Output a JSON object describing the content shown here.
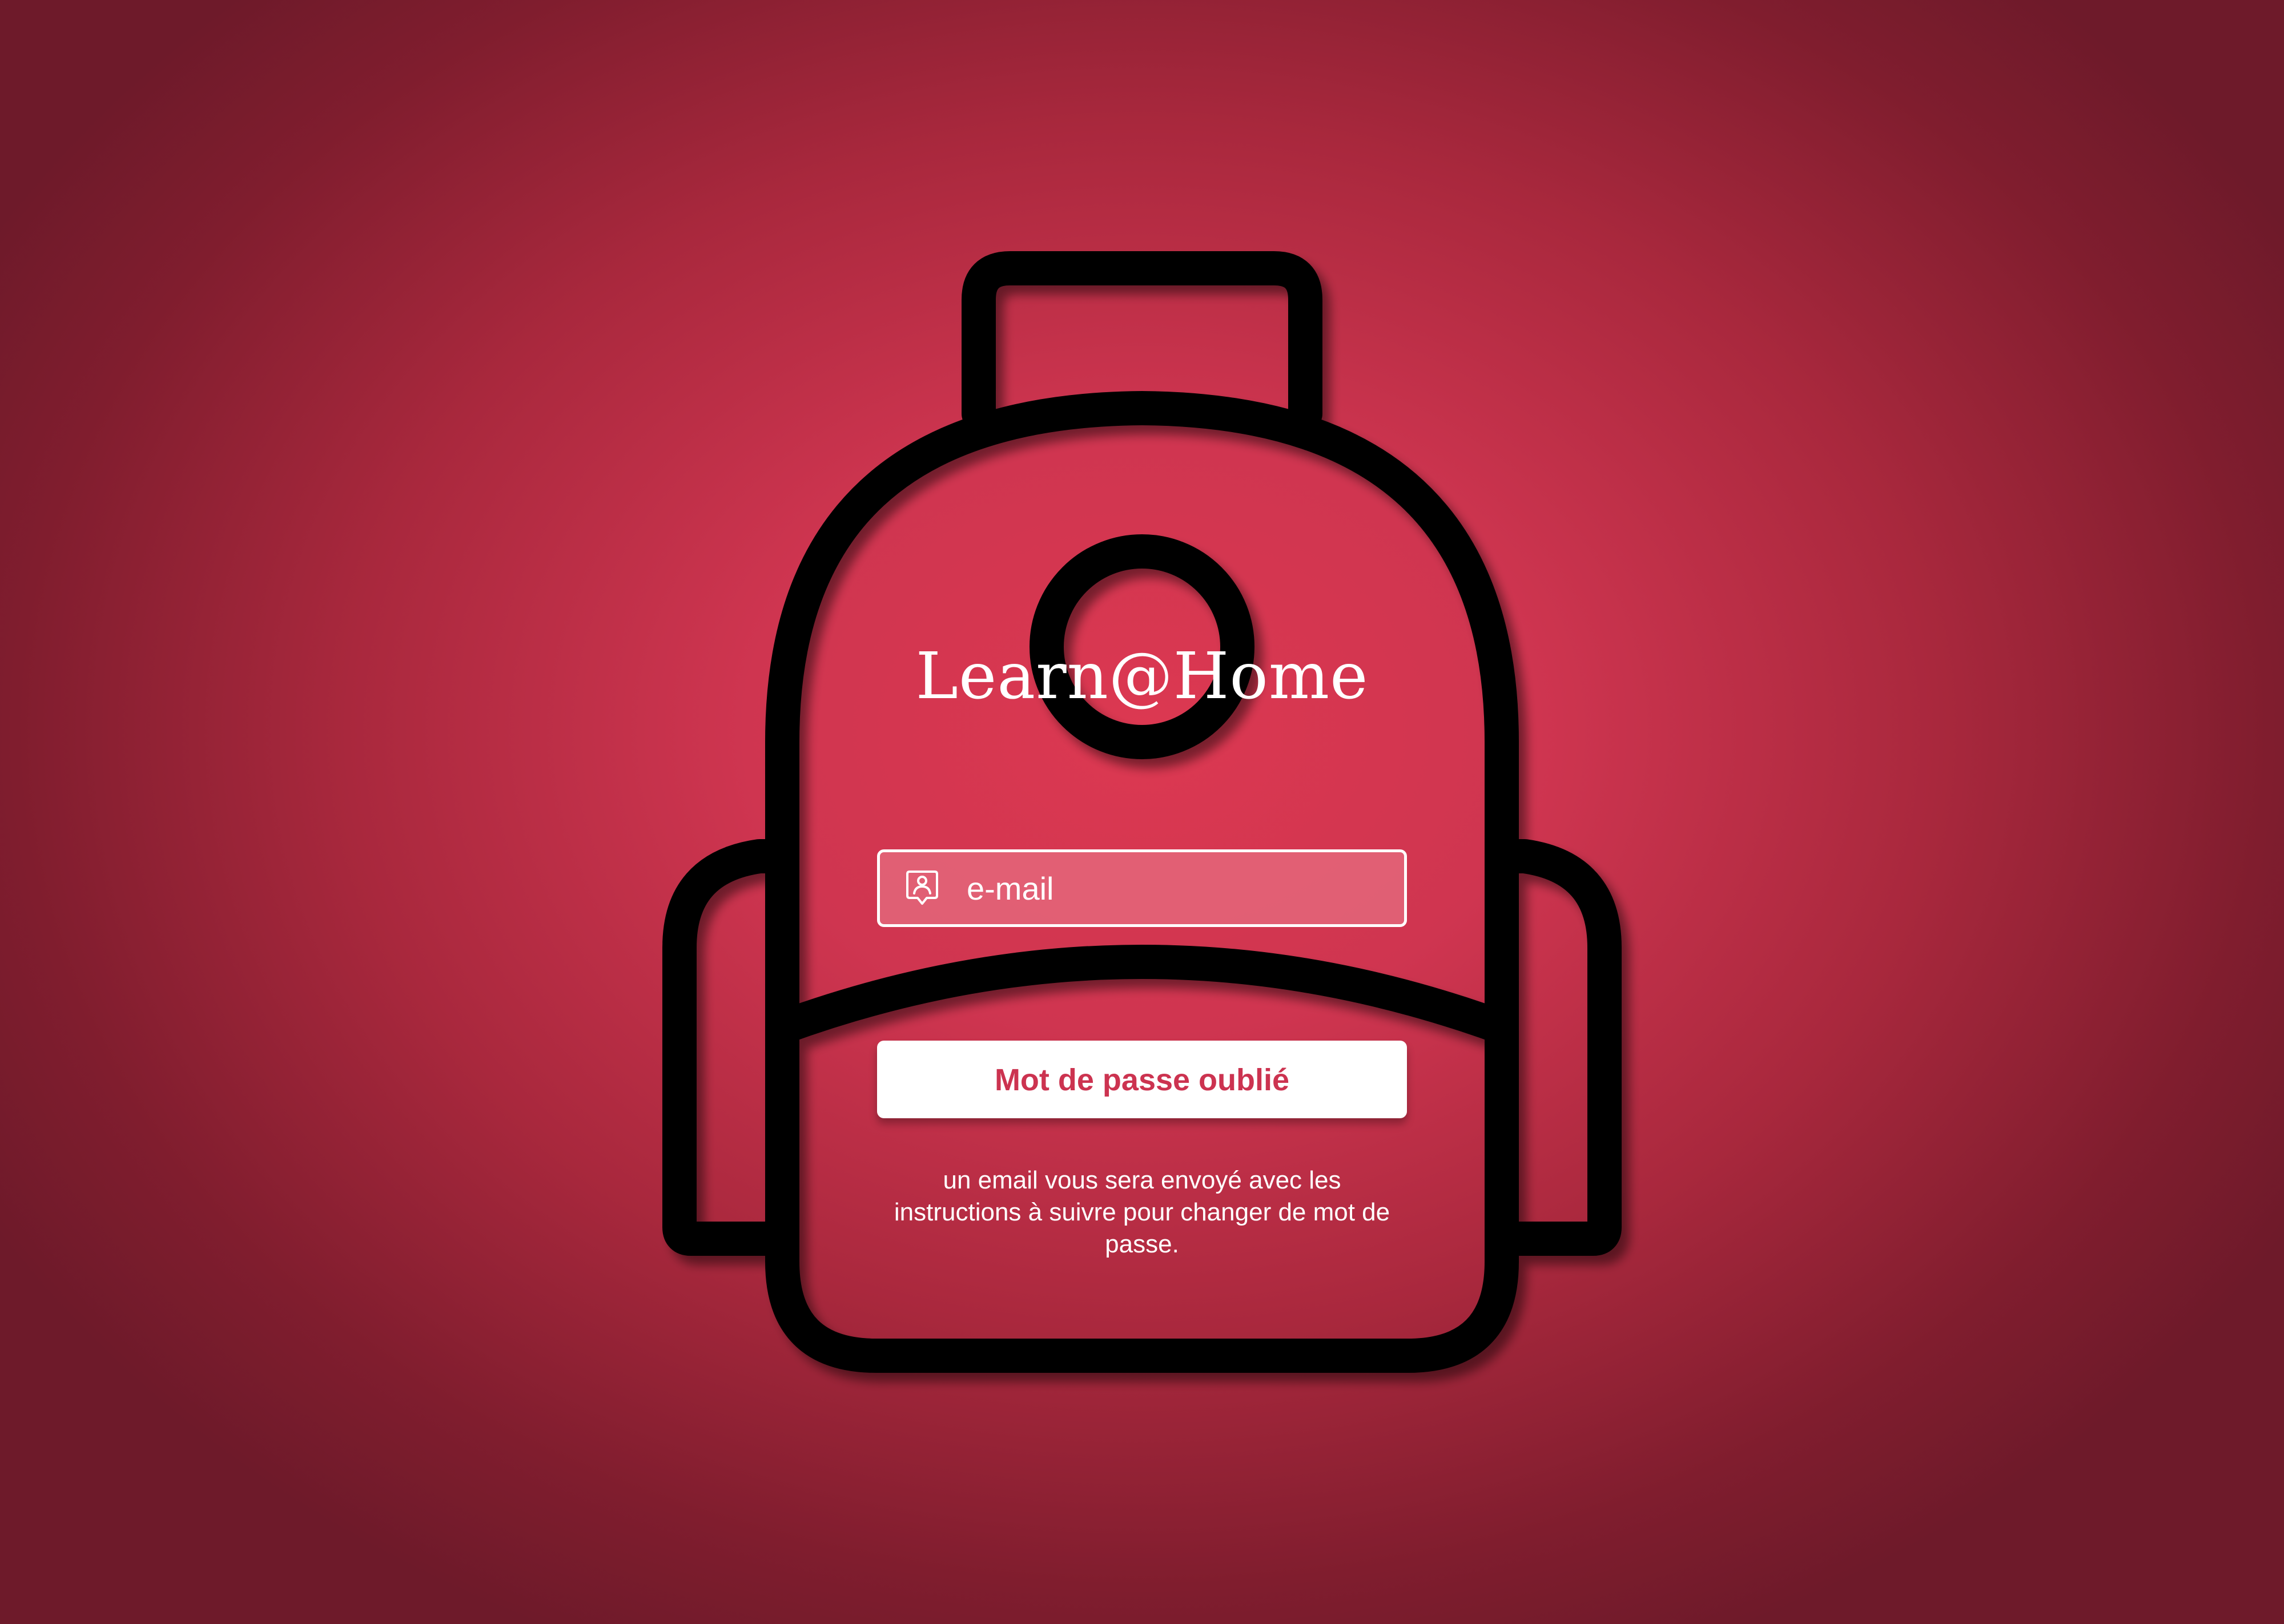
{
  "app": {
    "title": "Learn@Home"
  },
  "form": {
    "email_placeholder": "e-mail",
    "email_value": "",
    "submit_label": "Mot de passe oublié",
    "help_text": "un email vous sera envoyé avec les instructions à suivre pour changer de mot de passe."
  },
  "icons": {
    "email_field_icon": "user-badge-icon",
    "illustration": "backpack-icon"
  },
  "colors": {
    "background_center": "#dc3851",
    "background_edge": "#6e1a2a",
    "accent": "#cc3350",
    "outline": "#000000",
    "text": "#ffffff"
  }
}
